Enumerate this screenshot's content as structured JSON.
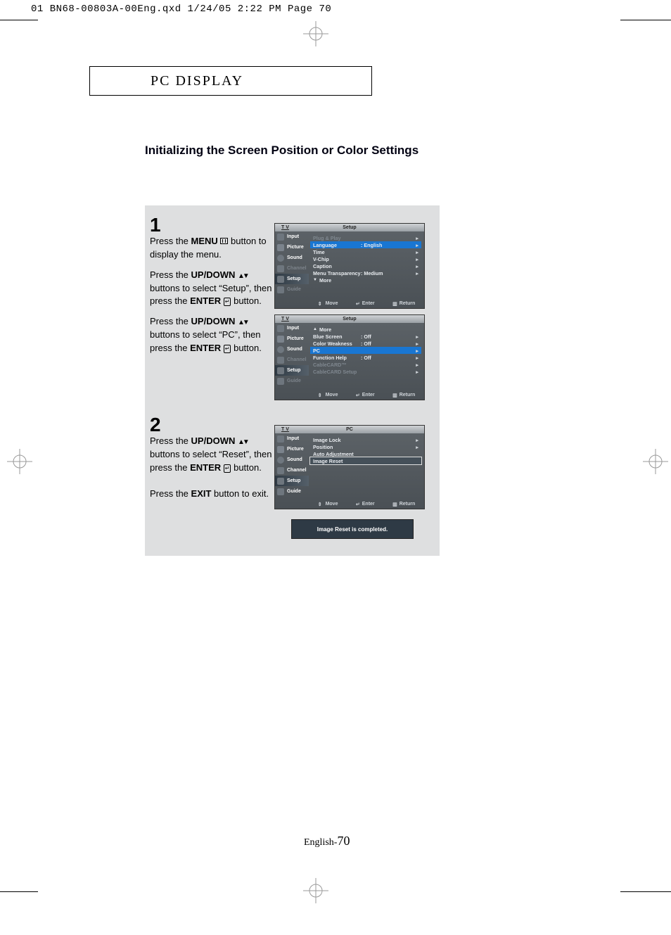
{
  "header": "01 BN68-00803A-00Eng.qxd  1/24/05 2:22 PM  Page 70",
  "section_label": "PC DISPLAY",
  "page_title": "Initializing the Screen Position or Color Settings",
  "steps": {
    "s1_num": "1",
    "s1_p1a": "Press the ",
    "s1_p1b": "MENU",
    "s1_p1c": " button to display the menu.",
    "s1_p2a": "Press the ",
    "s1_p2b": "UP/DOWN",
    "s1_p2c": " buttons to select “Setup”, then press the ",
    "s1_p2d": "ENTER",
    "s1_p2e": " button.",
    "s1_p3a": "Press the ",
    "s1_p3b": "UP/DOWN",
    "s1_p3c": " buttons to select “PC”, then press the ",
    "s1_p3d": "ENTER",
    "s1_p3e": " button.",
    "s2_num": "2",
    "s2_p1a": "Press the ",
    "s2_p1b": "UP/DOWN",
    "s2_p1c": " buttons to select “Reset”, then press the ",
    "s2_p1d": "ENTER",
    "s2_p1e": " button.",
    "s2_p2a": "Press the ",
    "s2_p2b": "EXIT",
    "s2_p2c": " button to exit."
  },
  "osd": {
    "tv": "T V",
    "tabs": {
      "input": "Input",
      "picture": "Picture",
      "sound": "Sound",
      "channel": "Channel",
      "setup": "Setup",
      "guide": "Guide"
    },
    "footer": {
      "move": "Move",
      "enter": "Enter",
      "return": "Return"
    },
    "screenA": {
      "title": "Setup",
      "items": [
        {
          "label": "Plug & Play",
          "dim": true,
          "arr": true
        },
        {
          "label": "Language",
          "val": ": English",
          "sel": true,
          "arr": true
        },
        {
          "label": "Time",
          "arr": true
        },
        {
          "label": "V-Chip",
          "arr": true
        },
        {
          "label": "Caption",
          "arr": true
        },
        {
          "label": "Menu Transparency",
          "val": ": Medium",
          "arr": true
        },
        {
          "label": "More",
          "down": true
        }
      ]
    },
    "screenB": {
      "title": "Setup",
      "items": [
        {
          "label": "More",
          "up": true
        },
        {
          "label": "Blue Screen",
          "val": ": Off",
          "arr": true
        },
        {
          "label": "Color Weakness",
          "val": ": Off",
          "arr": true
        },
        {
          "label": "PC",
          "sel": true,
          "arr": true
        },
        {
          "label": "Function Help",
          "val": ": Off",
          "arr": true
        },
        {
          "label": "CableCARD™",
          "dim": true,
          "arr": true
        },
        {
          "label": "CableCARD Setup",
          "dim": true,
          "arr": true
        }
      ]
    },
    "screenC": {
      "title": "PC",
      "items": [
        {
          "label": "Image Lock",
          "arr": true
        },
        {
          "label": "Position",
          "arr": true
        },
        {
          "label": "Auto Adjustment"
        },
        {
          "label": "Image Reset",
          "hl": true
        }
      ]
    }
  },
  "toast": "Image Reset is completed.",
  "footer_lang": "English-",
  "footer_page": "70"
}
